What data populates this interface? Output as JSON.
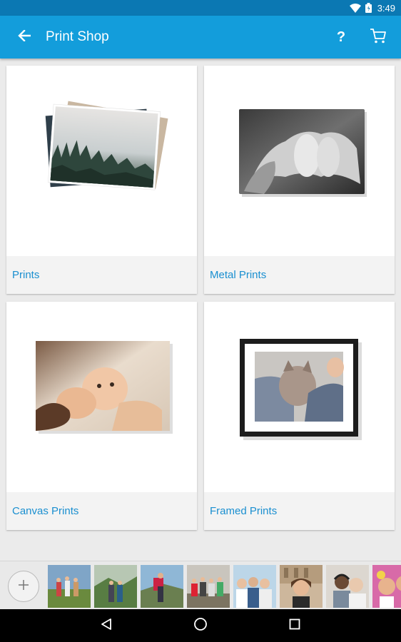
{
  "status_bar": {
    "time": "3:49",
    "icons": [
      "wifi-icon",
      "battery-icon"
    ]
  },
  "app_bar": {
    "title": "Print Shop",
    "back_icon": "arrow-left-icon",
    "help_label": "?",
    "cart_icon": "cart-icon",
    "color": "#139ddb"
  },
  "products": [
    {
      "label": "Prints",
      "image": "stacked-prints-forest"
    },
    {
      "label": "Metal Prints",
      "image": "metal-print-baby-feet"
    },
    {
      "label": "Canvas Prints",
      "image": "canvas-mother-baby"
    },
    {
      "label": "Framed Prints",
      "image": "framed-print-cat"
    }
  ],
  "photo_tray": {
    "add_icon": "plus-icon",
    "photos": [
      "group-hikers",
      "couple-mountain",
      "hiker-backpack",
      "friends-group",
      "friends-selfie",
      "woman-colosseum",
      "couple-headphones",
      "women-color-run"
    ]
  },
  "nav_bar": {
    "icons": [
      "back-triangle-icon",
      "home-circle-icon",
      "recents-square-icon"
    ]
  },
  "colors": {
    "accent": "#139ddb",
    "label": "#1a8fd0",
    "status": "#0b78b3"
  }
}
